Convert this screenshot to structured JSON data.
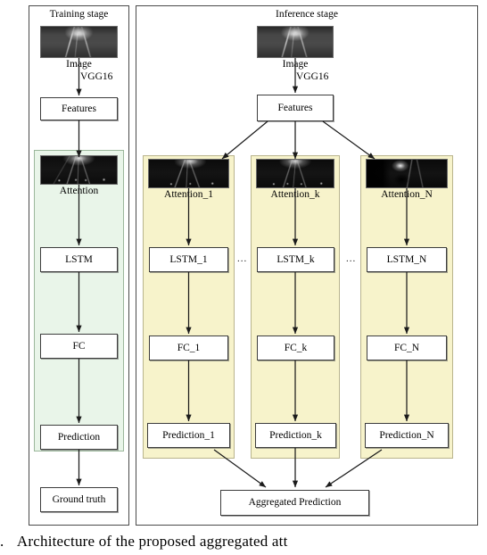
{
  "figure": {
    "caption": "Architecture  of  the  proposed  aggregated  att",
    "caption_prefix": "."
  },
  "training_stage": {
    "title": "Training stage",
    "image_thumb_label": "Image",
    "encoder_label": "VGG16",
    "features_label": "Features",
    "attention_label": "Attention",
    "lstm_label": "LSTM",
    "fc_label": "FC",
    "prediction_label": "Prediction",
    "ground_truth_label": "Ground truth",
    "panel_color": "#e9f5e9"
  },
  "inference_stage": {
    "title": "Inference stage",
    "image_thumb_label": "Image",
    "encoder_label": "VGG16",
    "features_label": "Features",
    "aggregated_label": "Aggregated Prediction",
    "panel_color": "#f7f3cb",
    "ellipsis": "...",
    "branches": [
      {
        "attention_label": "Attention_1",
        "lstm_label": "LSTM_1",
        "fc_label": "FC_1",
        "prediction_label": "Prediction_1"
      },
      {
        "attention_label": "Attention_k",
        "lstm_label": "LSTM_k",
        "fc_label": "FC_k",
        "prediction_label": "Prediction_k"
      },
      {
        "attention_label": "Attention_N",
        "lstm_label": "LSTM_N",
        "fc_label": "FC_N",
        "prediction_label": "Prediction_N"
      }
    ]
  }
}
